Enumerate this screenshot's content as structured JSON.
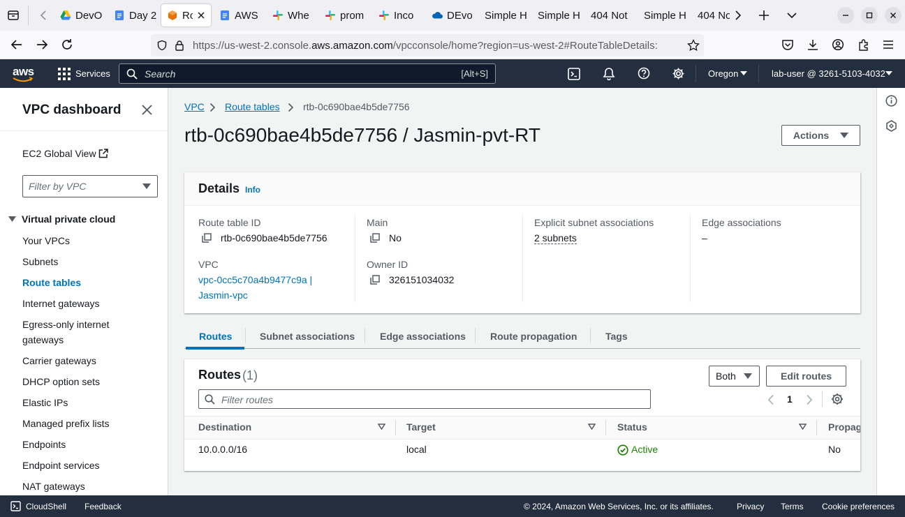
{
  "browser": {
    "tabs": [
      {
        "title": "DevO",
        "icon": "google-drive-icon"
      },
      {
        "title": "Day 2",
        "icon": "google-docs-icon"
      },
      {
        "title": "Ro",
        "icon": "aws-vpc-icon",
        "active": true
      },
      {
        "title": "AWS",
        "icon": "google-docs-icon"
      },
      {
        "title": "Whe",
        "icon": "slack-icon"
      },
      {
        "title": "prom",
        "icon": "slack-icon"
      },
      {
        "title": "Inco",
        "icon": "slack-icon"
      },
      {
        "title": "DEvo",
        "icon": "onedrive-icon"
      },
      {
        "title": "Simple H",
        "icon": ""
      },
      {
        "title": "Simple H",
        "icon": ""
      },
      {
        "title": "404 Not",
        "icon": ""
      },
      {
        "title": "Simple H",
        "icon": ""
      },
      {
        "title": "404 No",
        "icon": ""
      }
    ],
    "url_prefix": "https://us-west-2.console.",
    "url_domain": "aws.amazon.com",
    "url_path": "/vpcconsole/home?region=us-west-2#RouteTableDetails:"
  },
  "aws_header": {
    "logo": "aws",
    "services_label": "Services",
    "search_placeholder": "Search",
    "search_shortcut": "[Alt+S]",
    "region": "Oregon",
    "account": "lab-user @ 3261-5103-4032"
  },
  "sidebar": {
    "title": "VPC dashboard",
    "ec2_global_view": "EC2 Global View",
    "filter_placeholder": "Filter by VPC",
    "section": "Virtual private cloud",
    "items": [
      {
        "label": "Your VPCs",
        "active": false
      },
      {
        "label": "Subnets",
        "active": false
      },
      {
        "label": "Route tables",
        "active": true
      },
      {
        "label": "Internet gateways",
        "active": false
      },
      {
        "label": "Egress-only internet gateways",
        "active": false
      },
      {
        "label": "Carrier gateways",
        "active": false
      },
      {
        "label": "DHCP option sets",
        "active": false
      },
      {
        "label": "Elastic IPs",
        "active": false
      },
      {
        "label": "Managed prefix lists",
        "active": false
      },
      {
        "label": "Endpoints",
        "active": false
      },
      {
        "label": "Endpoint services",
        "active": false
      },
      {
        "label": "NAT gateways",
        "active": false
      }
    ]
  },
  "breadcrumb": {
    "vpc": "VPC",
    "route_tables": "Route tables",
    "current": "rtb-0c690bae4b5de7756"
  },
  "page": {
    "title": "rtb-0c690bae4b5de7756 / Jasmin-pvt-RT",
    "actions_label": "Actions"
  },
  "details": {
    "heading": "Details",
    "info": "Info",
    "route_table_id_label": "Route table ID",
    "route_table_id": "rtb-0c690bae4b5de7756",
    "main_label": "Main",
    "main": "No",
    "explicit_label": "Explicit subnet associations",
    "explicit": "2 subnets",
    "edge_label": "Edge associations",
    "edge": "–",
    "vpc_label": "VPC",
    "vpc_line1": "vpc-0cc5c70a4b9477c9a |",
    "vpc_line2": "Jasmin-vpc",
    "owner_label": "Owner ID",
    "owner": "326151034032"
  },
  "tabs": [
    "Routes",
    "Subnet associations",
    "Edge associations",
    "Route propagation",
    "Tags"
  ],
  "routes": {
    "heading": "Routes",
    "count": "(1)",
    "filter_select": "Both",
    "edit_label": "Edit routes",
    "filter_placeholder": "Filter routes",
    "page": "1",
    "columns": [
      "Destination",
      "Target",
      "Status",
      "Propag"
    ],
    "rows": [
      {
        "destination": "10.0.0.0/16",
        "target": "local",
        "status": "Active",
        "propagated": "No"
      }
    ]
  },
  "footer": {
    "cloudshell": "CloudShell",
    "feedback": "Feedback",
    "copyright": "© 2024, Amazon Web Services, Inc. or its affiliates.",
    "privacy": "Privacy",
    "terms": "Terms",
    "cookies": "Cookie preferences"
  },
  "colors": {
    "aws_header": "#232f3e",
    "link": "#0073bb",
    "active_tab": "#0073bb",
    "status_ok": "#1d8102",
    "aws_orange": "#ff9900"
  }
}
